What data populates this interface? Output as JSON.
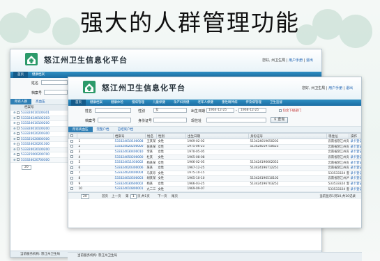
{
  "headline": "强大的人群管理功能",
  "app": {
    "title": "怒江州卫生信息化平台",
    "greeting": "您好, 州卫生局",
    "user_manual": "用户手册",
    "logout": "退出",
    "footer": "当前服务机构: 怒江州卫生局"
  },
  "colors": {
    "nav": "#1a6da3",
    "accent": "#2f7fb5",
    "link": "#1a5fb0"
  },
  "nav_tabs": [
    "首页",
    "健康档案",
    "健康体检",
    "慢病管理",
    "儿童保健",
    "孕产妇保健",
    "老年人保健",
    "重性精神病",
    "传染病管理",
    "卫生监督"
  ],
  "back": {
    "fields": {
      "name": "姓名",
      "record_no": "档案号"
    },
    "subtabs": [
      "所有人群",
      "高血压"
    ],
    "col_record": "档案号",
    "records": [
      "533324010100301",
      "533324240102203",
      "533324010100200",
      "533324010100200",
      "533324020200300",
      "533321020000300",
      "533324020201300",
      "533324020100200",
      "533325000200700",
      "533324020700300"
    ],
    "page_size": "20"
  },
  "search": {
    "name_label": "姓名",
    "gender_label": "性别",
    "gender_value": "女",
    "birth_label": "出生日期",
    "birth_from": "1964-12-25",
    "birth_to": "1968-12-25",
    "lower_org_label": "包含下级部门",
    "record_label": "档案号",
    "id_label": "身份证号",
    "address_label": "现住址",
    "query_button": "查询"
  },
  "subtabs": [
    "所有高血压",
    "完整户档",
    "已结案户档"
  ],
  "table": {
    "columns": [
      "档案号",
      "姓名",
      "性别",
      "出生日期",
      "身份证号",
      "现住址",
      "操作"
    ],
    "rows": [
      [
        "533324010100008",
        "王某某",
        "女性",
        "1969-02-02",
        "513424019650202",
        "云南省怒江州贡山县某某乡"
      ],
      [
        "533324020200000",
        "张某某",
        "女性",
        "1975-06-23",
        "513424019750623",
        "云南省怒江州贡山县某某乡"
      ],
      [
        "533324030400010",
        "李某",
        "女性",
        "1970-05-05",
        "",
        "云南省怒江州贡山县某某乡"
      ],
      [
        "533324050200000",
        "杜某",
        "女性",
        "1965-08-08",
        "",
        "云南省怒江州贡山县某某乡"
      ],
      [
        "533324011030002",
        "杨某某",
        "女性",
        "1966-02-05",
        "513424196602052",
        "云南省怒江州贡山县某某乡"
      ],
      [
        "533324020300006",
        "某某",
        "女性",
        "1967-12-25",
        "513424196712251",
        "云南省怒江州贡山县某某乡"
      ],
      [
        "533324020400004",
        "马某珍",
        "女性",
        "1975-10-15",
        "",
        "533533324 澄江县怒江州"
      ],
      [
        "533324010500003",
        "胡某某",
        "女性",
        "1965-10-10",
        "513424196510102",
        "云南省怒江州泸水县某某乡"
      ],
      [
        "533324030600002",
        "杨某",
        "女性",
        "1966-03-25",
        "513424196703252",
        "533533324 澄江县怒江州"
      ],
      [
        "533324010800001",
        "九二三",
        "女性",
        "1969-09-07",
        "",
        "533533324 澄江县怒江州"
      ]
    ],
    "action": "录卡登记"
  },
  "pager": {
    "first": "首页",
    "prev": "上一页",
    "page_label": "第",
    "page_value": "1",
    "of_total": "页,共1页",
    "next": "下一页",
    "last": "尾页",
    "page_size": "20",
    "summary": "当前显示1到10,共10记录"
  }
}
